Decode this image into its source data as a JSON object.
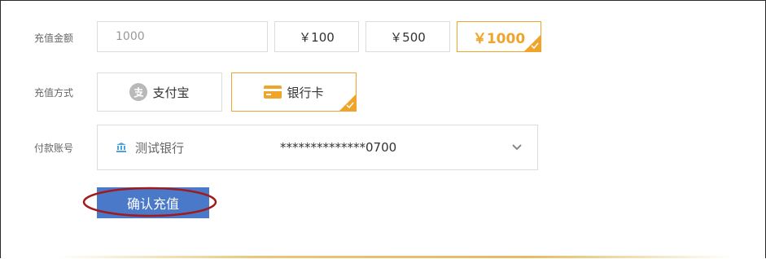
{
  "amount": {
    "label": "充值金额",
    "input_value": "1000",
    "options": [
      {
        "label": "￥100",
        "selected": false
      },
      {
        "label": "￥500",
        "selected": false
      },
      {
        "label": "￥1000",
        "selected": true
      }
    ]
  },
  "method": {
    "label": "充值方式",
    "options": [
      {
        "label": "支付宝",
        "icon": "alipay-icon",
        "selected": false
      },
      {
        "label": "银行卡",
        "icon": "bank-card-icon",
        "selected": true
      }
    ]
  },
  "account": {
    "label": "付款账号",
    "bank_name": "测试银行",
    "card_number": "**************0700",
    "icon": "bank-icon"
  },
  "confirm": {
    "label": "确认充值"
  },
  "colors": {
    "accent": "#f0a52a",
    "primary_button": "#4a79c9",
    "annotation_ellipse": "#a01c1c"
  }
}
